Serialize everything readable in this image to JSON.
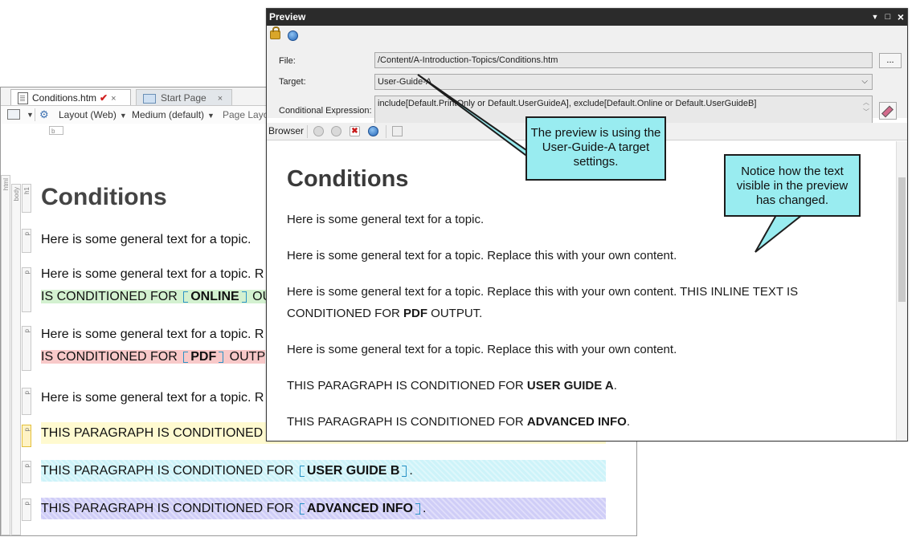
{
  "editor": {
    "tabs": [
      {
        "label": "Conditions.htm",
        "active": true,
        "close": "×"
      },
      {
        "label": "Start Page",
        "active": false,
        "close": "×"
      }
    ],
    "toolbar": {
      "layout": "Layout (Web)",
      "medium": "Medium (default)",
      "page_layout": "Page Layo"
    },
    "struct_labels": {
      "html": "html",
      "body": "body",
      "h1": "h1",
      "p": "p",
      "mini_b": "b"
    },
    "heading": "Conditions",
    "paragraphs": [
      "Here is some general text for a topic.",
      "Here is some general text for a topic. R",
      "IS CONDITIONED FOR ",
      "ONLINE",
      " OU",
      "Here is some general text for a topic. R",
      "IS CONDITIONED FOR ",
      "PDF",
      " OUTP",
      "Here is some general text for a topic. R",
      "THIS PARAGRAPH IS CONDITIONED",
      "THIS PARAGRAPH IS CONDITIONED FOR ",
      "USER GUIDE B",
      ".",
      "THIS PARAGRAPH IS CONDITIONED FOR ",
      "ADVANCED INFO",
      "."
    ]
  },
  "preview": {
    "title": "Preview",
    "window_buttons": {
      "menu": "▼",
      "maximize": "□",
      "close": "×"
    },
    "file_label": "File:",
    "file_value": "/Content/A-Introduction-Topics/Conditions.htm",
    "browse_button": "...",
    "target_label": "Target:",
    "target_value": "User-Guide-A",
    "cond_label": "Conditional Expression:",
    "cond_value": "include[Default.PrintOnly or Default.UserGuideA], exclude[Default.Online or Default.UserGuideB]",
    "browser_label": "Browser",
    "heading": "Conditions",
    "paragraphs": [
      {
        "text": "Here is some general text for a topic."
      },
      {
        "text": "Here is some general text for a topic. Replace this with your own content."
      },
      {
        "text": "Here is some general text for a topic. Replace this with your own content. THIS INLINE TEXT IS"
      },
      {
        "text": "CONDITIONED FOR ",
        "bold": "PDF",
        "after": " OUTPUT."
      },
      {
        "text": "Here is some general text for a topic. Replace this with your own content."
      },
      {
        "text": "THIS PARAGRAPH IS CONDITIONED FOR ",
        "bold": "USER GUIDE A",
        "after": "."
      },
      {
        "text": "THIS PARAGRAPH IS CONDITIONED FOR ",
        "bold": "ADVANCED INFO",
        "after": "."
      }
    ]
  },
  "callouts": {
    "target": "The preview is using the User-Guide-A target settings.",
    "notice": "Notice how the text visible in the preview has changed."
  },
  "colors": {
    "callout_fill": "#99ecf0",
    "online_highlight": "#d3f1d0",
    "pdf_highlight": "#f8c9c9",
    "condition_yellow": "#fffad0",
    "condition_cyan": "#cdf3f9",
    "condition_purple": "#cfcdf7",
    "titlebar": "#2b2b2b"
  }
}
